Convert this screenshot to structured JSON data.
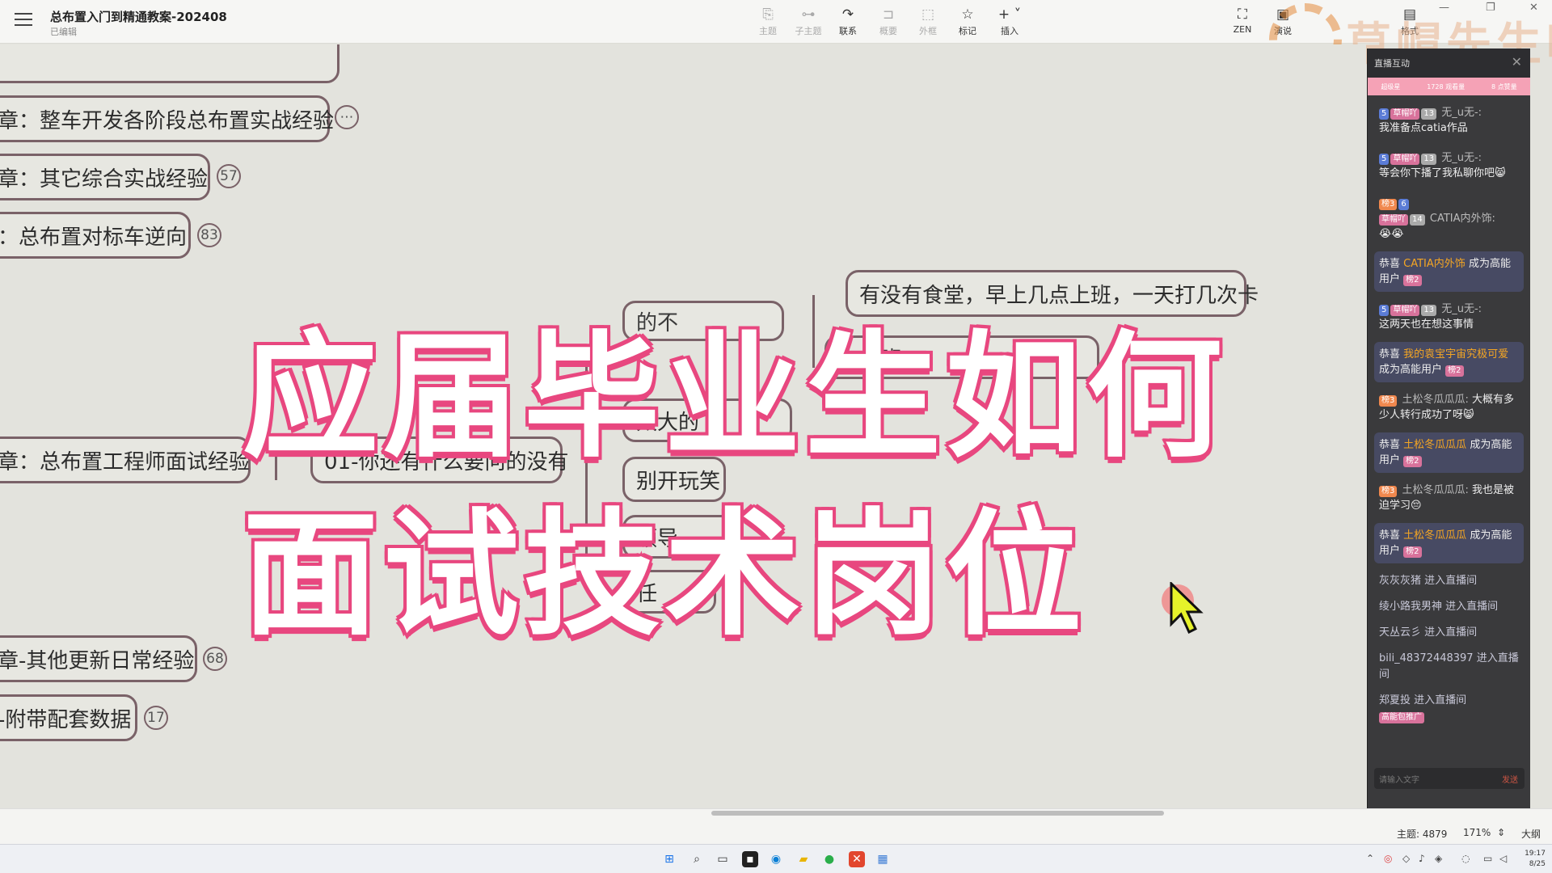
{
  "app": {
    "doc_title": "总布置入门到精通教案-202408",
    "doc_status": "已编辑"
  },
  "toolbar": {
    "items": [
      {
        "label": "主题",
        "icon": "topic-icon"
      },
      {
        "label": "子主题",
        "icon": "subtopic-icon"
      },
      {
        "label": "联系",
        "icon": "relation-icon"
      },
      {
        "label": "概要",
        "icon": "summary-icon"
      },
      {
        "label": "外框",
        "icon": "boundary-icon"
      },
      {
        "label": "标记",
        "icon": "star-icon"
      },
      {
        "label": "插入",
        "icon": "plus-icon"
      }
    ],
    "right_items": [
      {
        "label": "ZEN",
        "icon": "fullscreen-icon"
      },
      {
        "label": "演说",
        "icon": "pitch-icon"
      },
      {
        "label": "格式",
        "icon": "format-icon"
      }
    ]
  },
  "mindmap": {
    "nodes": [
      {
        "label": "章：整车开发各阶段总布置实战经验",
        "badge": "⋯"
      },
      {
        "label": "章：其它综合实战经验",
        "badge": "57"
      },
      {
        "label": "：总布置对标车逆向",
        "badge": "83"
      },
      {
        "label": "章：总布置工程师面试经验",
        "badge": ""
      },
      {
        "label": "章-其他更新日常经验",
        "badge": "68"
      },
      {
        "label": "-附带配套数据",
        "badge": "17"
      }
    ],
    "sub_nodes": [
      {
        "label": "01-你还有什么要问的没有"
      },
      {
        "label": "有没有食堂，早上几点上班，一天打几次卡"
      },
      {
        "label": "别开玩笑"
      }
    ],
    "ghost_text": [
      "的不",
      "有加班",
      "太大的",
      "领导",
      "任"
    ]
  },
  "overlay": {
    "line1": "应届毕业生如何",
    "line2": "面试技术岗位"
  },
  "watermark": {
    "text": "草帽先生吖"
  },
  "live_chat": {
    "header": "直播互动",
    "stats": [
      "超级星",
      "1728 观看量",
      "8 点赞量"
    ],
    "messages": [
      {
        "level": "5",
        "fan": "草帽吖",
        "fan_lv": "13",
        "user": "无_u无-:",
        "text": "我准备点catia作品"
      },
      {
        "level": "5",
        "fan": "草帽吖",
        "fan_lv": "13",
        "user": "无_u无-:",
        "text": "等会你下播了我私聊你吧😸"
      },
      {
        "rank": "榜3",
        "level": "6",
        "fan": "草帽吖",
        "fan_lv": "14",
        "user": "CATIA内外饰:",
        "text": "😭😭"
      },
      {
        "congrats": "恭喜",
        "user": "CATIA内外饰",
        "text": "成为高能用户",
        "rank": "榜2",
        "highlight": true
      },
      {
        "level": "5",
        "fan": "草帽吖",
        "fan_lv": "13",
        "user": "无_u无-:",
        "text": "这两天也在想这事情"
      },
      {
        "congrats": "恭喜",
        "user": "我的袁宝宇宙究极可爱",
        "text": "成为高能用户",
        "rank": "榜2",
        "highlight": true
      },
      {
        "rank": "榜3",
        "user": "土松冬瓜瓜瓜:",
        "text": "大概有多少人转行成功了呀😸"
      },
      {
        "congrats": "恭喜",
        "user": "土松冬瓜瓜瓜",
        "text": "成为高能用户",
        "rank": "榜2",
        "highlight": true
      },
      {
        "rank": "榜3",
        "user": "土松冬瓜瓜瓜:",
        "text": "我也是被迫学习😔"
      },
      {
        "congrats": "恭喜",
        "user": "土松冬瓜瓜瓜",
        "text": "成为高能用户",
        "rank": "榜2",
        "highlight": true
      }
    ],
    "enters": [
      "灰灰灰猪 进入直播间",
      "绫小路我男神 进入直播间",
      "天丛云彡 进入直播间",
      "bili_48372448397 进入直播间",
      "郑夏投 进入直播间"
    ],
    "enter_tag": "高能包推广",
    "input_placeholder": "请输入文字",
    "send": "发送"
  },
  "statusbar": {
    "topic_count": "主题: 4879",
    "zoom": "171%",
    "outline": "大纲"
  },
  "clock": {
    "time": "19:17",
    "date": "8/25"
  }
}
